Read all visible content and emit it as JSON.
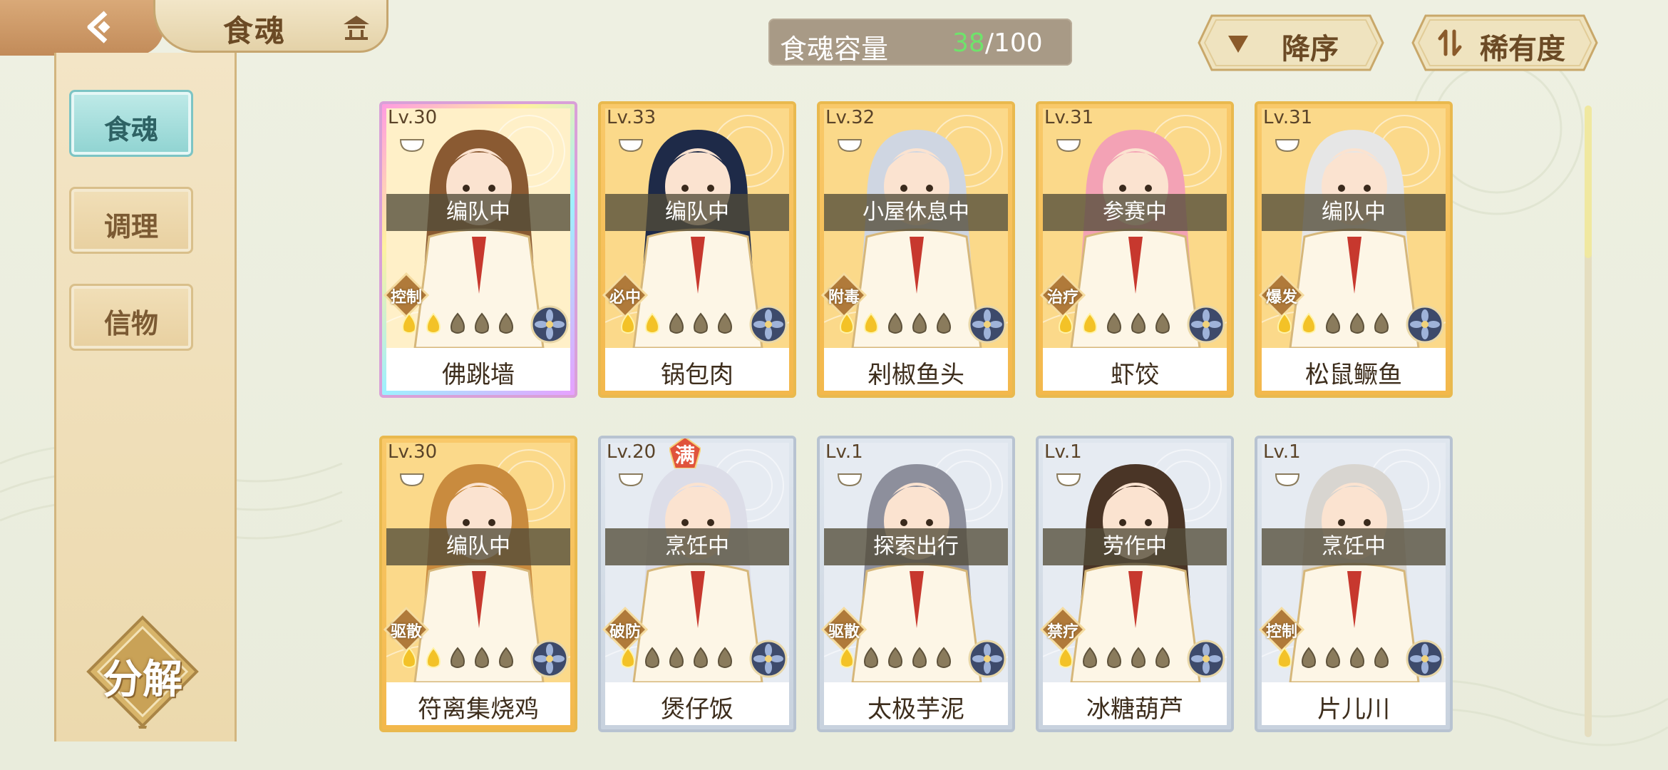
{
  "header": {
    "title": "食魂",
    "capacity_label": "食魂容量",
    "capacity_current": "38",
    "capacity_total": "/100",
    "sort_order_label": "降序",
    "sort_by_label": "稀有度"
  },
  "sidebar": {
    "items": [
      {
        "label": "食魂",
        "active": true
      },
      {
        "label": "调理",
        "active": false
      },
      {
        "label": "信物",
        "active": false
      }
    ],
    "decompose_label": "分解"
  },
  "cards": [
    {
      "level": "Lv.30",
      "status": "编队中",
      "role": "控制",
      "name": "佛跳墙",
      "frame": "rainbow",
      "stars": 2,
      "hair": "#8a5a32"
    },
    {
      "level": "Lv.33",
      "status": "编队中",
      "role": "必中",
      "name": "锅包肉",
      "frame": "gold",
      "stars": 2,
      "hair": "#1e2a48"
    },
    {
      "level": "Lv.32",
      "status": "小屋休息中",
      "role": "附毒",
      "name": "剁椒鱼头",
      "frame": "gold",
      "stars": 2,
      "hair": "#cfd6e2"
    },
    {
      "level": "Lv.31",
      "status": "参赛中",
      "role": "治疗",
      "name": "虾饺",
      "frame": "gold",
      "stars": 2,
      "hair": "#f3a2b5"
    },
    {
      "level": "Lv.31",
      "status": "编队中",
      "role": "爆发",
      "name": "松鼠鳜鱼",
      "frame": "gold",
      "stars": 2,
      "hair": "#e6e6e6"
    },
    {
      "level": "Lv.30",
      "status": "编队中",
      "role": "驱散",
      "name": "符离集烧鸡",
      "frame": "gold",
      "stars": 2,
      "hair": "#c98b3e"
    },
    {
      "level": "Lv.20",
      "status": "烹饪中",
      "role": "破防",
      "name": "煲仔饭",
      "frame": "silver",
      "stars": 1,
      "hair": "#dcdde8",
      "badge": "满"
    },
    {
      "level": "Lv.1",
      "status": "探索出行",
      "role": "驱散",
      "name": "太极芋泥",
      "frame": "silver",
      "stars": 1,
      "hair": "#8d8f9c"
    },
    {
      "level": "Lv.1",
      "status": "劳作中",
      "role": "禁疗",
      "name": "冰糖葫芦",
      "frame": "silver",
      "stars": 1,
      "hair": "#4a3526"
    },
    {
      "level": "Lv.1",
      "status": "烹饪中",
      "role": "控制",
      "name": "片儿川",
      "frame": "silver",
      "stars": 1,
      "hair": "#d8d5d0"
    }
  ],
  "colors": {
    "accent_green": "#6fe36b",
    "header_brown": "#6b4a25",
    "active_tab": "#8fd3d1"
  }
}
